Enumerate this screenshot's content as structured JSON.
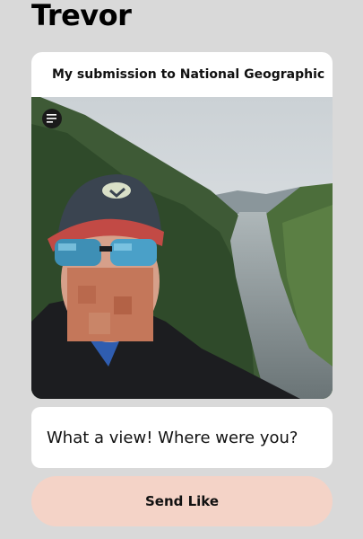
{
  "profile": {
    "name": "Trevor"
  },
  "card": {
    "title": "My submission to National Geographic",
    "photo_icon": "menu-lines-icon"
  },
  "reply": {
    "value": "What a view! Where were you?"
  },
  "actions": {
    "send_label": "Send Like"
  },
  "colors": {
    "background": "#d9d9d9",
    "card": "#ffffff",
    "send_button": "#f4d3c7"
  }
}
